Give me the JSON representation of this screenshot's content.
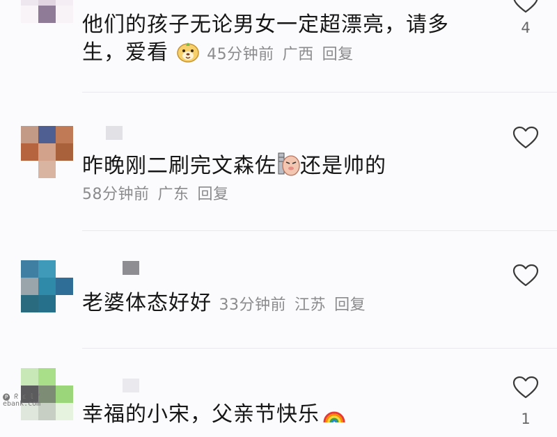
{
  "comments": [
    {
      "text_line1": "他们的孩子无论男女一定超漂亮，请多",
      "text_line2": "生，爱看",
      "time": "45分钟前",
      "location": "广西",
      "reply": "回复",
      "likes": "4"
    },
    {
      "text": "昨晚刚二刷完文森佐",
      "text_after_emoji": "还是帅的",
      "time": "58分钟前",
      "location": "广东",
      "reply": "回复",
      "likes": ""
    },
    {
      "text": "老婆体态好好",
      "time": "33分钟前",
      "location": "江苏",
      "reply": "回复",
      "likes": ""
    },
    {
      "text": "幸福的小宋，父亲节快乐",
      "likes": "1"
    }
  ],
  "watermark": {
    "line1": "🅟 ᖇ 𝕔 𝕝 ‘",
    "line2": "ebank.com"
  }
}
